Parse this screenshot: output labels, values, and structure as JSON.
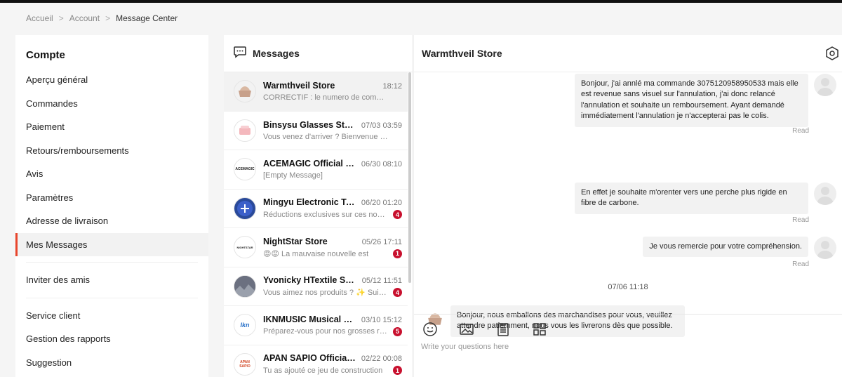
{
  "breadcrumb": [
    "Accueil",
    "Account",
    "Message Center"
  ],
  "sidebar": {
    "title": "Compte",
    "items": [
      "Aperçu général",
      "Commandes",
      "Paiement",
      "Retours/remboursements",
      "Avis",
      "Paramètres",
      "Adresse de livraison",
      "Mes Messages"
    ],
    "extra": [
      "Inviter des amis"
    ],
    "support": [
      "Service client",
      "Gestion des rapports",
      "Suggestion"
    ]
  },
  "messages_panel": {
    "title": "Messages",
    "conversations": [
      {
        "name": "Warmthveil Store",
        "time": "18:12",
        "preview": "CORRECTIF : le numero de commande",
        "badge": "",
        "selected": true
      },
      {
        "name": "Binsysu Glasses Store",
        "time": "07/03 03:59",
        "preview": "Vous venez d'arriver ? Bienvenue ! Vous",
        "badge": ""
      },
      {
        "name": "ACEMAGIC Official Store",
        "time": "06/30 08:10",
        "preview": "[Empty Message]",
        "badge": "",
        "avatar_text": "ACEMAGIC"
      },
      {
        "name": "Mingyu Electronic Technology",
        "time": "06/20 01:20",
        "preview": "Réductions exclusives sur ces nouveautés",
        "badge": "4"
      },
      {
        "name": "NightStar Store",
        "time": "05/26 17:11",
        "preview": "La mauvaise nouvelle est",
        "badge": "1",
        "avatar_text": "NIGHTSTAR"
      },
      {
        "name": "Yvonicky HTextile Store",
        "time": "05/12 11:51",
        "preview": "Vous aimez nos produits ? ✨ Suivez",
        "badge": "4"
      },
      {
        "name": "IKNMUSIC Musical Store",
        "time": "03/10 15:12",
        "preview": "Préparez-vous pour nos grosses réductions",
        "badge": "5",
        "avatar_text": "Ikn"
      },
      {
        "name": "APAN SAPIO Official Store",
        "time": "02/22 00:08",
        "preview": "Tu as ajouté ce jeu de construction",
        "badge": "1",
        "avatar_text": "APAN SAPIO"
      }
    ]
  },
  "chat": {
    "store_name": "Warmthveil Store",
    "messages": [
      {
        "text": "Bonjour, j'ai annlé ma commande 3075120958950533 mais elle est revenue sans visuel sur l'annulation, j'ai donc relancé l'annulation et souhaite un remboursement. Ayant demandé immédiatement l'annulation je n'accepterai pas le colis.",
        "status": "Read"
      },
      {
        "text": "En effet je souhaite m'orenter vers une perche plus rigide en fibre de carbone.",
        "status": "Read"
      },
      {
        "text": "Je vous remercie pour votre compréhension.",
        "status": "Read"
      }
    ],
    "date_separator": "07/06 11:18",
    "incoming": "Bonjour, nous emballons des marchandises pour vous, veuillez attendre patiemment, nous vous les livrerons dès que possible.",
    "input_placeholder": "Write your questions here"
  },
  "colors": {
    "accent": "#e8452c",
    "badge": "#c8102e"
  }
}
